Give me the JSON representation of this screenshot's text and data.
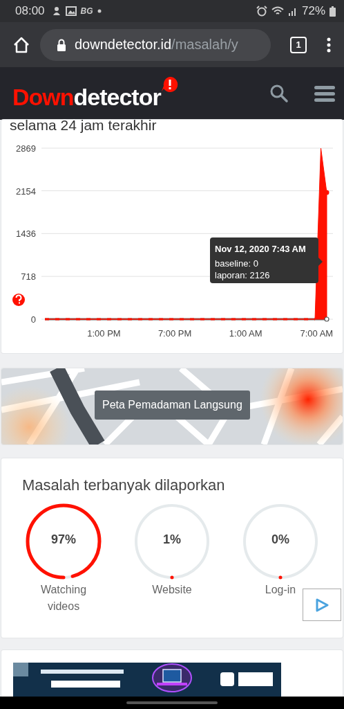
{
  "status_bar": {
    "time": "08:00",
    "indicator": "BG",
    "battery": "72%"
  },
  "browser": {
    "url_host": "downdetector.id",
    "url_path": "/masalah/y",
    "tab_count": "1"
  },
  "header": {
    "logo_red": "Down",
    "logo_white": "detector"
  },
  "chart_card": {
    "title": "selama 24 jam terakhir",
    "chart_data": {
      "type": "area",
      "grid": true,
      "series": [
        {
          "color": "#ff1100",
          "values": [
            0,
            0,
            0,
            0,
            0,
            0,
            0,
            0,
            0,
            0,
            0,
            0,
            0,
            0,
            0,
            0,
            0,
            0,
            0,
            0,
            0,
            0,
            0,
            0,
            0,
            0,
            0,
            0,
            0,
            0,
            0,
            0,
            0,
            0,
            0,
            0,
            0,
            0,
            0,
            0,
            0,
            0,
            0,
            0,
            0,
            0,
            0,
            2869,
            2126
          ]
        }
      ],
      "ylim": [
        0,
        2869
      ],
      "yticks": [
        0,
        718,
        1436,
        2154,
        2869
      ]
    },
    "x_labels": [
      "1:00 PM",
      "7:00 PM",
      "1:00 AM",
      "7:00 AM"
    ],
    "tooltip": {
      "title": "Nov 12, 2020 7:43 AM",
      "lines": [
        "baseline: 0",
        "laporan: 2126"
      ]
    }
  },
  "map_card": {
    "button": "Peta Pemadaman Langsung"
  },
  "problems_card": {
    "title": "Masalah terbanyak dilaporkan",
    "items": [
      {
        "percent": "97%",
        "label": "Watching videos",
        "level": 0.97
      },
      {
        "percent": "1%",
        "label": "Website",
        "level": 0.01
      },
      {
        "percent": "0%",
        "label": "Log-in",
        "level": 0
      }
    ]
  }
}
